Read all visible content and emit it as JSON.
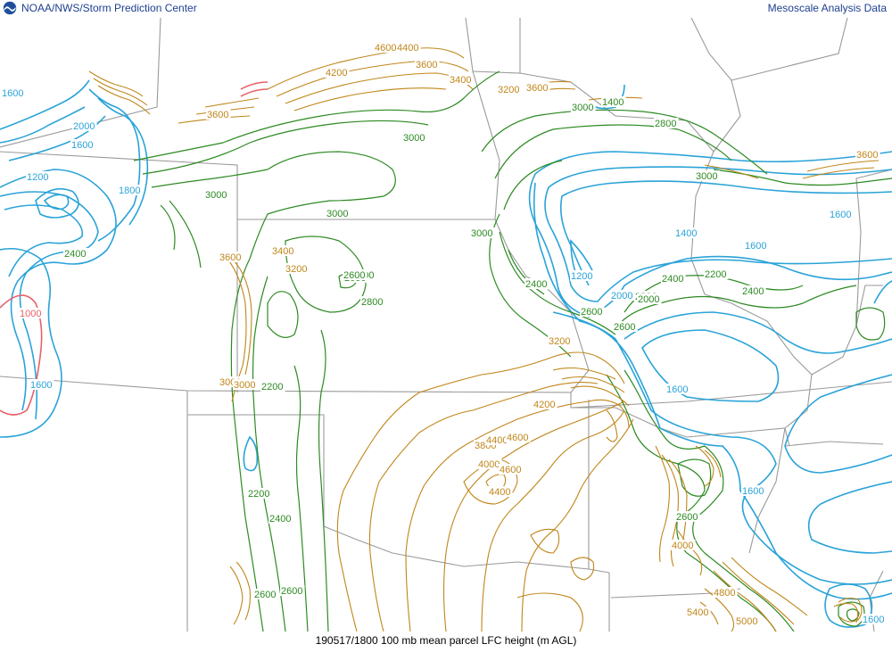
{
  "header": {
    "left_title": "NOAA/NWS/Storm Prediction Center",
    "right_title": "Mesoscale Analysis Data",
    "logo_icon": "noaa-logo"
  },
  "caption": "190517/1800 100 mb mean parcel LFC height (m AGL)",
  "colors": {
    "borders": "#9a9a9a",
    "low": "#e8606a",
    "blue": "#2aa3d8",
    "green": "#2d8a22",
    "brown": "#c0861a"
  },
  "contour_labels": [
    {
      "t": "1600",
      "c": "blue"
    },
    {
      "t": "2000",
      "c": "blue"
    },
    {
      "t": "1600",
      "c": "blue"
    },
    {
      "t": "1200",
      "c": "blue"
    },
    {
      "t": "1000",
      "c": "low"
    },
    {
      "t": "1600",
      "c": "blue"
    },
    {
      "t": "1800",
      "c": "blue"
    },
    {
      "t": "2400",
      "c": "green"
    },
    {
      "t": "2600",
      "c": "green"
    },
    {
      "t": "2800",
      "c": "green"
    },
    {
      "t": "3000",
      "c": "green"
    },
    {
      "t": "3000",
      "c": "green"
    },
    {
      "t": "3000",
      "c": "green"
    },
    {
      "t": "3000",
      "c": "green"
    },
    {
      "t": "2800",
      "c": "green"
    },
    {
      "t": "2600",
      "c": "green"
    },
    {
      "t": "2200",
      "c": "green"
    },
    {
      "t": "2200",
      "c": "green"
    },
    {
      "t": "2400",
      "c": "green"
    },
    {
      "t": "2600",
      "c": "green"
    },
    {
      "t": "3400",
      "c": "brown"
    },
    {
      "t": "3200",
      "c": "brown"
    },
    {
      "t": "3600",
      "c": "brown"
    },
    {
      "t": "3000",
      "c": "brown"
    },
    {
      "t": "3000",
      "c": "brown"
    },
    {
      "t": "4600",
      "c": "brown"
    },
    {
      "t": "4400",
      "c": "brown"
    },
    {
      "t": "3600",
      "c": "brown"
    },
    {
      "t": "3400",
      "c": "brown"
    },
    {
      "t": "3200",
      "c": "brown"
    },
    {
      "t": "3600",
      "c": "brown"
    },
    {
      "t": "4200",
      "c": "brown"
    },
    {
      "t": "3800",
      "c": "brown"
    },
    {
      "t": "4000",
      "c": "brown"
    },
    {
      "t": "4400",
      "c": "brown"
    },
    {
      "t": "4600",
      "c": "brown"
    },
    {
      "t": "4200",
      "c": "brown"
    },
    {
      "t": "4600",
      "c": "brown"
    },
    {
      "t": "4400",
      "c": "brown"
    },
    {
      "t": "3200",
      "c": "brown"
    },
    {
      "t": "3600",
      "c": "brown"
    },
    {
      "t": "3000",
      "c": "green"
    },
    {
      "t": "2800",
      "c": "green"
    },
    {
      "t": "3000",
      "c": "green"
    },
    {
      "t": "2400",
      "c": "green"
    },
    {
      "t": "2600",
      "c": "green"
    },
    {
      "t": "1400",
      "c": "blue"
    },
    {
      "t": "1200",
      "c": "blue"
    },
    {
      "t": "1600",
      "c": "blue"
    },
    {
      "t": "2000",
      "c": "blue"
    },
    {
      "t": "2200",
      "c": "green"
    },
    {
      "t": "2400",
      "c": "green"
    },
    {
      "t": "2200",
      "c": "green"
    },
    {
      "t": "2400",
      "c": "green"
    },
    {
      "t": "1600",
      "c": "blue"
    },
    {
      "t": "1600",
      "c": "blue"
    },
    {
      "t": "1600",
      "c": "blue"
    },
    {
      "t": "1600",
      "c": "blue"
    },
    {
      "t": "2600",
      "c": "green"
    },
    {
      "t": "2000",
      "c": "green"
    },
    {
      "t": "3600",
      "c": "brown"
    },
    {
      "t": "2600",
      "c": "green"
    },
    {
      "t": "1400",
      "c": "green"
    },
    {
      "t": "4000",
      "c": "brown"
    },
    {
      "t": "4800",
      "c": "brown"
    },
    {
      "t": "5400",
      "c": "brown"
    },
    {
      "t": "5000",
      "c": "brown"
    },
    {
      "t": "2600",
      "c": "green"
    }
  ]
}
